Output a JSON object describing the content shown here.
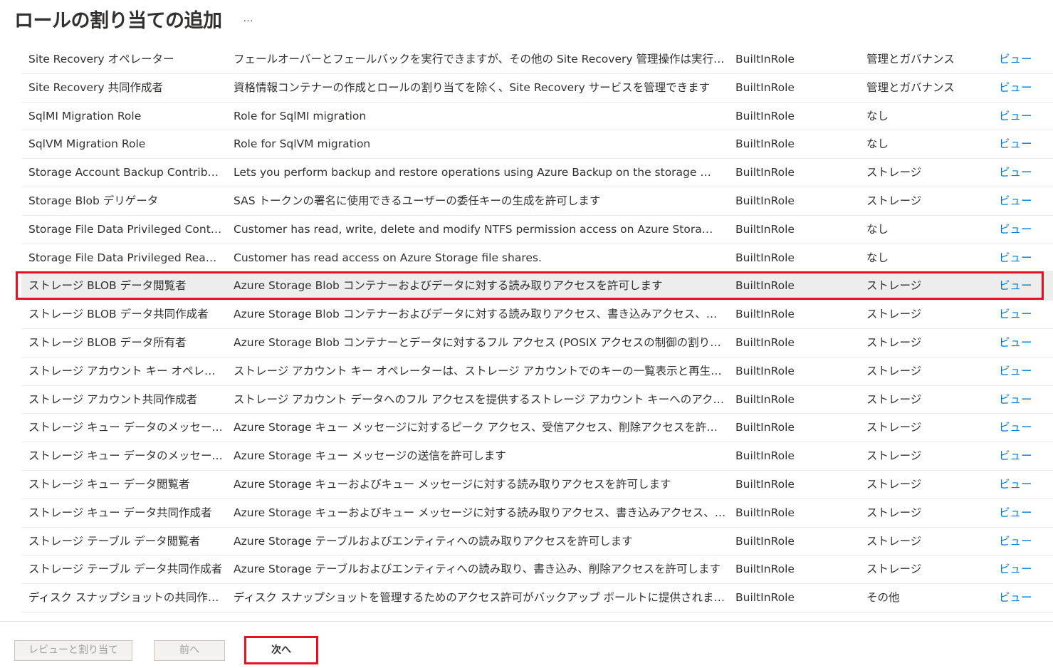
{
  "header": {
    "title": "ロールの割り当ての追加",
    "more_label": "…"
  },
  "colors": {
    "link": "#0078d4",
    "highlight": "#e81123",
    "selected_row": "#ededed"
  },
  "roles": [
    {
      "name": "Site Recovery オペレーター",
      "description": "フェールオーバーとフェールバックを実行できますが、その他の Site Recovery 管理操作は実行しません",
      "type": "BuiltInRole",
      "category": "管理とガバナンス",
      "view": "ビュー"
    },
    {
      "name": "Site Recovery 共同作成者",
      "description": "資格情報コンテナーの作成とロールの割り当てを除く、Site Recovery サービスを管理できます",
      "type": "BuiltInRole",
      "category": "管理とガバナンス",
      "view": "ビュー"
    },
    {
      "name": "SqlMI Migration Role",
      "description": "Role for SqlMI migration",
      "type": "BuiltInRole",
      "category": "なし",
      "view": "ビュー"
    },
    {
      "name": "SqlVM Migration Role",
      "description": "Role for SqlVM migration",
      "type": "BuiltInRole",
      "category": "なし",
      "view": "ビュー"
    },
    {
      "name": "Storage Account Backup Contrib…",
      "description": "Lets you perform backup and restore operations using Azure Backup on the storage …",
      "type": "BuiltInRole",
      "category": "ストレージ",
      "view": "ビュー"
    },
    {
      "name": "Storage Blob デリゲータ",
      "description": "SAS トークンの署名に使用できるユーザーの委任キーの生成を許可します",
      "type": "BuiltInRole",
      "category": "ストレージ",
      "view": "ビュー"
    },
    {
      "name": "Storage File Data Privileged Cont…",
      "description": "Customer has read, write, delete and modify NTFS permission access on Azure Stora…",
      "type": "BuiltInRole",
      "category": "なし",
      "view": "ビュー"
    },
    {
      "name": "Storage File Data Privileged Rea…",
      "description": "Customer has read access on Azure Storage file shares.",
      "type": "BuiltInRole",
      "category": "なし",
      "view": "ビュー"
    },
    {
      "name": "ストレージ BLOB データ閲覧者",
      "description": "Azure Storage Blob コンテナーおよびデータに対する読み取りアクセスを許可します",
      "type": "BuiltInRole",
      "category": "ストレージ",
      "view": "ビュー",
      "selected": true
    },
    {
      "name": "ストレージ BLOB データ共同作成者",
      "description": "Azure Storage Blob コンテナーおよびデータに対する読み取りアクセス、書き込みアクセス、削除アクセス…",
      "type": "BuiltInRole",
      "category": "ストレージ",
      "view": "ビュー"
    },
    {
      "name": "ストレージ BLOB データ所有者",
      "description": "Azure Storage Blob コンテナーとデータに対するフル アクセス (POSIX アクセスの制御の割り当てを含む…",
      "type": "BuiltInRole",
      "category": "ストレージ",
      "view": "ビュー"
    },
    {
      "name": "ストレージ アカウント キー オペレーターの…",
      "description": "ストレージ アカウント キー オペレーターは、ストレージ アカウントでのキーの一覧表示と再生成を行うことがで…",
      "type": "BuiltInRole",
      "category": "ストレージ",
      "view": "ビュー"
    },
    {
      "name": "ストレージ アカウント共同作成者",
      "description": "ストレージ アカウント データへのフル アクセスを提供するストレージ アカウント キーへのアクセスなど、ストレ…",
      "type": "BuiltInRole",
      "category": "ストレージ",
      "view": "ビュー"
    },
    {
      "name": "ストレージ キュー データのメッセージ プロ…",
      "description": "Azure Storage キュー メッセージに対するピーク アクセス、受信アクセス、削除アクセスを許可します",
      "type": "BuiltInRole",
      "category": "ストレージ",
      "view": "ビュー"
    },
    {
      "name": "ストレージ キュー データのメッセージ送信者",
      "description": "Azure Storage キュー メッセージの送信を許可します",
      "type": "BuiltInRole",
      "category": "ストレージ",
      "view": "ビュー"
    },
    {
      "name": "ストレージ キュー データ閲覧者",
      "description": "Azure Storage キューおよびキュー メッセージに対する読み取りアクセスを許可します",
      "type": "BuiltInRole",
      "category": "ストレージ",
      "view": "ビュー"
    },
    {
      "name": "ストレージ キュー データ共同作成者",
      "description": "Azure Storage キューおよびキュー メッセージに対する読み取りアクセス、書き込みアクセス、削除アクセス…",
      "type": "BuiltInRole",
      "category": "ストレージ",
      "view": "ビュー"
    },
    {
      "name": "ストレージ テーブル データ閲覧者",
      "description": "Azure Storage テーブルおよびエンティティへの読み取りアクセスを許可します",
      "type": "BuiltInRole",
      "category": "ストレージ",
      "view": "ビュー"
    },
    {
      "name": "ストレージ テーブル データ共同作成者",
      "description": "Azure Storage テーブルおよびエンティティへの読み取り、書き込み、削除アクセスを許可します",
      "type": "BuiltInRole",
      "category": "ストレージ",
      "view": "ビュー"
    },
    {
      "name": "ディスク スナップショットの共同作成者",
      "description": "ディスク スナップショットを管理するためのアクセス許可がバックアップ ボールトに提供されます。",
      "type": "BuiltInRole",
      "category": "その他",
      "view": "ビュー"
    }
  ],
  "footer": {
    "review_assign_label": "レビューと割り当て",
    "prev_label": "前へ",
    "next_label": "次へ"
  }
}
